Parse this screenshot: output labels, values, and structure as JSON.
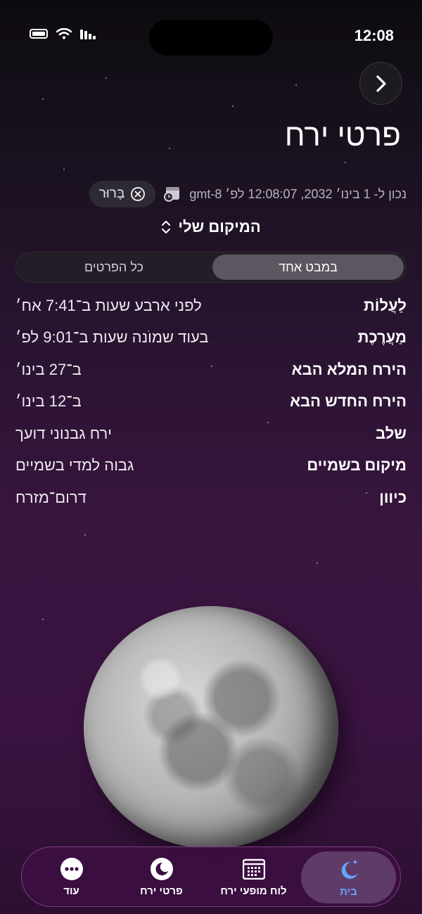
{
  "status_bar": {
    "time": "12:08"
  },
  "header": {
    "title": "פרטי ירח",
    "back_icon": "chevron-right-icon"
  },
  "meta": {
    "timestamp": "נכון ל- 1 בינו׳ 2032, 12:08:07 לפ׳ gmt-8",
    "clear_label": "בָּרוּר"
  },
  "location": {
    "label": "המיקום שלי"
  },
  "segmented": {
    "active": "במבט אחד",
    "inactive": "כל הפרטים"
  },
  "details": [
    {
      "label": "לַעֲלוֹת",
      "value": "לפני ארבע שעות ב־7:41 אח׳"
    },
    {
      "label": "מַעֲרֶכֶת",
      "value": "בעוד שמונה שעות ב־9:01 לפ׳"
    },
    {
      "label": "הירח המלא הבא",
      "value": "ב־27 בינו׳"
    },
    {
      "label": "הירח החדש הבא",
      "value": "ב־12 בינו׳"
    },
    {
      "label": "שלב",
      "value": "ירח גבנוני דועך"
    },
    {
      "label": "מיקום בשמיים",
      "value": "גבוה למדי בשמיים"
    },
    {
      "label": "כיוון",
      "value": "דרום־מזרח"
    }
  ],
  "tabbar": {
    "home": "בית",
    "calendar": "לוח מופעי ירח",
    "moon_details": "פרטי ירח",
    "more": "עוד"
  },
  "colors": {
    "accent": "#63a5ff",
    "tabbar_bg": "#3c0e40"
  }
}
